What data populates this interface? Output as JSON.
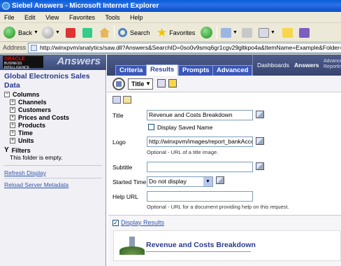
{
  "window": {
    "title": "Siebel Answers - Microsoft Internet Explorer"
  },
  "menu": [
    "File",
    "Edit",
    "View",
    "Favorites",
    "Tools",
    "Help"
  ],
  "toolbar": {
    "back_label": "Back",
    "search_label": "Search",
    "favorites_label": "Favorites"
  },
  "address": {
    "label": "Address",
    "url": "http://winxpvm/analytics/saw.dll?Answers&SearchID=0so0v9smq6gr1cgv29gltkpo4a&ItemName=Example&Folder=/use"
  },
  "brand": {
    "oracle_line1": "ORACLE",
    "oracle_line2": "BUSINESS INTELLIGENCE",
    "product": "Answers"
  },
  "left": {
    "subject_area": "Global Electronics Sales Data",
    "columns_label": "Columns",
    "folders": [
      "Channels",
      "Customers",
      "Prices and Costs",
      "Products",
      "Time",
      "Units"
    ],
    "filters_label": "Filters",
    "filters_empty": "This folder is empty.",
    "links": [
      "Refresh Display",
      "Reload Server Metadata"
    ]
  },
  "tabs": {
    "items": [
      "Criteria",
      "Results",
      "Prompts",
      "Advanced"
    ],
    "active": "Results",
    "dashboards": "Dashboards",
    "answers": "Answers",
    "advanced_reports": "Advanced Reporting"
  },
  "view": {
    "selected": "Title"
  },
  "form": {
    "title_label": "Title",
    "title_value": "Revenue and Costs Breakdown",
    "display_saved_name": "Display Saved Name",
    "logo_label": "Logo",
    "logo_value": "http://winxpvm/images/report_bankAccou",
    "logo_hint": "Optional - URL of a title image.",
    "subtitle_label": "Subtitle",
    "subtitle_value": "",
    "started_time_label": "Started Time",
    "started_time_value": "Do not display",
    "help_url_label": "Help URL",
    "help_url_value": "",
    "help_url_hint": "Optional - URL for a document providing help on this request."
  },
  "results": {
    "display_results_label": "Display Results",
    "display_results_checked": true,
    "report_title": "Revenue and Costs Breakdown"
  }
}
